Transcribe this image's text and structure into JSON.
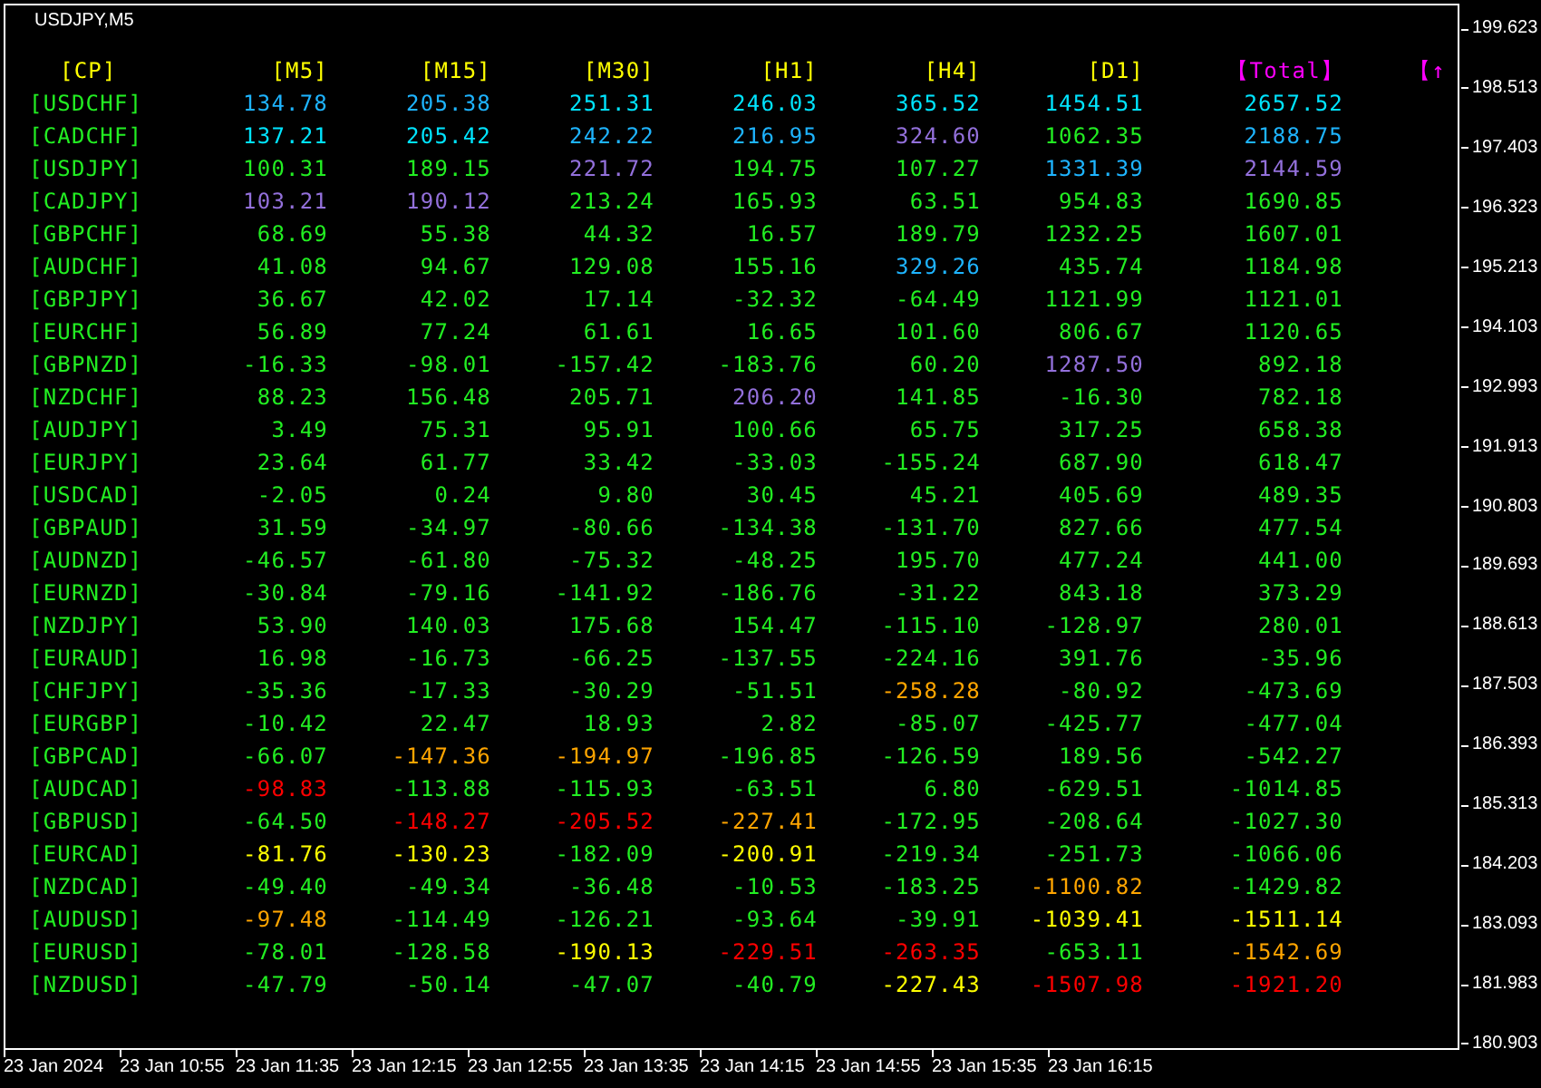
{
  "chart": {
    "symbol": "USDJPY,M5"
  },
  "table": {
    "columns": [
      {
        "label": "[CP]",
        "color": "#ffff00"
      },
      {
        "label": "[M5]",
        "color": "#ffff00"
      },
      {
        "label": "[M15]",
        "color": "#ffff00"
      },
      {
        "label": "[M30]",
        "color": "#ffff00"
      },
      {
        "label": "[H1]",
        "color": "#ffff00"
      },
      {
        "label": "[H4]",
        "color": "#ffff00"
      },
      {
        "label": "[D1]",
        "color": "#ffff00"
      },
      {
        "label": "【Total】",
        "color": "#ff00ff"
      },
      {
        "label": "【↑",
        "color": "#ff00ff"
      }
    ],
    "rows": [
      {
        "cells": [
          {
            "value": "[USDCHF]",
            "color": "#22ee22"
          },
          {
            "value": "134.78",
            "color": "#1eb4ff"
          },
          {
            "value": "205.38",
            "color": "#1eb4ff"
          },
          {
            "value": "251.31",
            "color": "#00e4ff"
          },
          {
            "value": "246.03",
            "color": "#00e4ff"
          },
          {
            "value": "365.52",
            "color": "#00e4ff"
          },
          {
            "value": "1454.51",
            "color": "#00e4ff"
          },
          {
            "value": "2657.52",
            "color": "#00e4ff"
          }
        ]
      },
      {
        "cells": [
          {
            "value": "[CADCHF]",
            "color": "#22ee22"
          },
          {
            "value": "137.21",
            "color": "#00e4ff"
          },
          {
            "value": "205.42",
            "color": "#00e4ff"
          },
          {
            "value": "242.22",
            "color": "#1eb4ff"
          },
          {
            "value": "216.95",
            "color": "#1eb4ff"
          },
          {
            "value": "324.60",
            "color": "#9370db"
          },
          {
            "value": "1062.35",
            "color": "#22ee22"
          },
          {
            "value": "2188.75",
            "color": "#1eb4ff"
          }
        ]
      },
      {
        "cells": [
          {
            "value": "[USDJPY]",
            "color": "#22ee22"
          },
          {
            "value": "100.31",
            "color": "#22ee22"
          },
          {
            "value": "189.15",
            "color": "#22ee22"
          },
          {
            "value": "221.72",
            "color": "#9370db"
          },
          {
            "value": "194.75",
            "color": "#22ee22"
          },
          {
            "value": "107.27",
            "color": "#22ee22"
          },
          {
            "value": "1331.39",
            "color": "#1eb4ff"
          },
          {
            "value": "2144.59",
            "color": "#9370db"
          }
        ]
      },
      {
        "cells": [
          {
            "value": "[CADJPY]",
            "color": "#22ee22"
          },
          {
            "value": "103.21",
            "color": "#9370db"
          },
          {
            "value": "190.12",
            "color": "#9370db"
          },
          {
            "value": "213.24",
            "color": "#22ee22"
          },
          {
            "value": "165.93",
            "color": "#22ee22"
          },
          {
            "value": "63.51",
            "color": "#22ee22"
          },
          {
            "value": "954.83",
            "color": "#22ee22"
          },
          {
            "value": "1690.85",
            "color": "#22ee22"
          }
        ]
      },
      {
        "cells": [
          {
            "value": "[GBPCHF]",
            "color": "#22ee22"
          },
          {
            "value": "68.69",
            "color": "#22ee22"
          },
          {
            "value": "55.38",
            "color": "#22ee22"
          },
          {
            "value": "44.32",
            "color": "#22ee22"
          },
          {
            "value": "16.57",
            "color": "#22ee22"
          },
          {
            "value": "189.79",
            "color": "#22ee22"
          },
          {
            "value": "1232.25",
            "color": "#22ee22"
          },
          {
            "value": "1607.01",
            "color": "#22ee22"
          }
        ]
      },
      {
        "cells": [
          {
            "value": "[AUDCHF]",
            "color": "#22ee22"
          },
          {
            "value": "41.08",
            "color": "#22ee22"
          },
          {
            "value": "94.67",
            "color": "#22ee22"
          },
          {
            "value": "129.08",
            "color": "#22ee22"
          },
          {
            "value": "155.16",
            "color": "#22ee22"
          },
          {
            "value": "329.26",
            "color": "#1eb4ff"
          },
          {
            "value": "435.74",
            "color": "#22ee22"
          },
          {
            "value": "1184.98",
            "color": "#22ee22"
          }
        ]
      },
      {
        "cells": [
          {
            "value": "[GBPJPY]",
            "color": "#22ee22"
          },
          {
            "value": "36.67",
            "color": "#22ee22"
          },
          {
            "value": "42.02",
            "color": "#22ee22"
          },
          {
            "value": "17.14",
            "color": "#22ee22"
          },
          {
            "value": "-32.32",
            "color": "#22ee22"
          },
          {
            "value": "-64.49",
            "color": "#22ee22"
          },
          {
            "value": "1121.99",
            "color": "#22ee22"
          },
          {
            "value": "1121.01",
            "color": "#22ee22"
          }
        ]
      },
      {
        "cells": [
          {
            "value": "[EURCHF]",
            "color": "#22ee22"
          },
          {
            "value": "56.89",
            "color": "#22ee22"
          },
          {
            "value": "77.24",
            "color": "#22ee22"
          },
          {
            "value": "61.61",
            "color": "#22ee22"
          },
          {
            "value": "16.65",
            "color": "#22ee22"
          },
          {
            "value": "101.60",
            "color": "#22ee22"
          },
          {
            "value": "806.67",
            "color": "#22ee22"
          },
          {
            "value": "1120.65",
            "color": "#22ee22"
          }
        ]
      },
      {
        "cells": [
          {
            "value": "[GBPNZD]",
            "color": "#22ee22"
          },
          {
            "value": "-16.33",
            "color": "#22ee22"
          },
          {
            "value": "-98.01",
            "color": "#22ee22"
          },
          {
            "value": "-157.42",
            "color": "#22ee22"
          },
          {
            "value": "-183.76",
            "color": "#22ee22"
          },
          {
            "value": "60.20",
            "color": "#22ee22"
          },
          {
            "value": "1287.50",
            "color": "#9370db"
          },
          {
            "value": "892.18",
            "color": "#22ee22"
          }
        ]
      },
      {
        "cells": [
          {
            "value": "[NZDCHF]",
            "color": "#22ee22"
          },
          {
            "value": "88.23",
            "color": "#22ee22"
          },
          {
            "value": "156.48",
            "color": "#22ee22"
          },
          {
            "value": "205.71",
            "color": "#22ee22"
          },
          {
            "value": "206.20",
            "color": "#9370db"
          },
          {
            "value": "141.85",
            "color": "#22ee22"
          },
          {
            "value": "-16.30",
            "color": "#22ee22"
          },
          {
            "value": "782.18",
            "color": "#22ee22"
          }
        ]
      },
      {
        "cells": [
          {
            "value": "[AUDJPY]",
            "color": "#22ee22"
          },
          {
            "value": "3.49",
            "color": "#22ee22"
          },
          {
            "value": "75.31",
            "color": "#22ee22"
          },
          {
            "value": "95.91",
            "color": "#22ee22"
          },
          {
            "value": "100.66",
            "color": "#22ee22"
          },
          {
            "value": "65.75",
            "color": "#22ee22"
          },
          {
            "value": "317.25",
            "color": "#22ee22"
          },
          {
            "value": "658.38",
            "color": "#22ee22"
          }
        ]
      },
      {
        "cells": [
          {
            "value": "[EURJPY]",
            "color": "#22ee22"
          },
          {
            "value": "23.64",
            "color": "#22ee22"
          },
          {
            "value": "61.77",
            "color": "#22ee22"
          },
          {
            "value": "33.42",
            "color": "#22ee22"
          },
          {
            "value": "-33.03",
            "color": "#22ee22"
          },
          {
            "value": "-155.24",
            "color": "#22ee22"
          },
          {
            "value": "687.90",
            "color": "#22ee22"
          },
          {
            "value": "618.47",
            "color": "#22ee22"
          }
        ]
      },
      {
        "cells": [
          {
            "value": "[USDCAD]",
            "color": "#22ee22"
          },
          {
            "value": "-2.05",
            "color": "#22ee22"
          },
          {
            "value": "0.24",
            "color": "#22ee22"
          },
          {
            "value": "9.80",
            "color": "#22ee22"
          },
          {
            "value": "30.45",
            "color": "#22ee22"
          },
          {
            "value": "45.21",
            "color": "#22ee22"
          },
          {
            "value": "405.69",
            "color": "#22ee22"
          },
          {
            "value": "489.35",
            "color": "#22ee22"
          }
        ]
      },
      {
        "cells": [
          {
            "value": "[GBPAUD]",
            "color": "#22ee22"
          },
          {
            "value": "31.59",
            "color": "#22ee22"
          },
          {
            "value": "-34.97",
            "color": "#22ee22"
          },
          {
            "value": "-80.66",
            "color": "#22ee22"
          },
          {
            "value": "-134.38",
            "color": "#22ee22"
          },
          {
            "value": "-131.70",
            "color": "#22ee22"
          },
          {
            "value": "827.66",
            "color": "#22ee22"
          },
          {
            "value": "477.54",
            "color": "#22ee22"
          }
        ]
      },
      {
        "cells": [
          {
            "value": "[AUDNZD]",
            "color": "#22ee22"
          },
          {
            "value": "-46.57",
            "color": "#22ee22"
          },
          {
            "value": "-61.80",
            "color": "#22ee22"
          },
          {
            "value": "-75.32",
            "color": "#22ee22"
          },
          {
            "value": "-48.25",
            "color": "#22ee22"
          },
          {
            "value": "195.70",
            "color": "#22ee22"
          },
          {
            "value": "477.24",
            "color": "#22ee22"
          },
          {
            "value": "441.00",
            "color": "#22ee22"
          }
        ]
      },
      {
        "cells": [
          {
            "value": "[EURNZD]",
            "color": "#22ee22"
          },
          {
            "value": "-30.84",
            "color": "#22ee22"
          },
          {
            "value": "-79.16",
            "color": "#22ee22"
          },
          {
            "value": "-141.92",
            "color": "#22ee22"
          },
          {
            "value": "-186.76",
            "color": "#22ee22"
          },
          {
            "value": "-31.22",
            "color": "#22ee22"
          },
          {
            "value": "843.18",
            "color": "#22ee22"
          },
          {
            "value": "373.29",
            "color": "#22ee22"
          }
        ]
      },
      {
        "cells": [
          {
            "value": "[NZDJPY]",
            "color": "#22ee22"
          },
          {
            "value": "53.90",
            "color": "#22ee22"
          },
          {
            "value": "140.03",
            "color": "#22ee22"
          },
          {
            "value": "175.68",
            "color": "#22ee22"
          },
          {
            "value": "154.47",
            "color": "#22ee22"
          },
          {
            "value": "-115.10",
            "color": "#22ee22"
          },
          {
            "value": "-128.97",
            "color": "#22ee22"
          },
          {
            "value": "280.01",
            "color": "#22ee22"
          }
        ]
      },
      {
        "cells": [
          {
            "value": "[EURAUD]",
            "color": "#22ee22"
          },
          {
            "value": "16.98",
            "color": "#22ee22"
          },
          {
            "value": "-16.73",
            "color": "#22ee22"
          },
          {
            "value": "-66.25",
            "color": "#22ee22"
          },
          {
            "value": "-137.55",
            "color": "#22ee22"
          },
          {
            "value": "-224.16",
            "color": "#22ee22"
          },
          {
            "value": "391.76",
            "color": "#22ee22"
          },
          {
            "value": "-35.96",
            "color": "#22ee22"
          }
        ]
      },
      {
        "cells": [
          {
            "value": "[CHFJPY]",
            "color": "#22ee22"
          },
          {
            "value": "-35.36",
            "color": "#22ee22"
          },
          {
            "value": "-17.33",
            "color": "#22ee22"
          },
          {
            "value": "-30.29",
            "color": "#22ee22"
          },
          {
            "value": "-51.51",
            "color": "#22ee22"
          },
          {
            "value": "-258.28",
            "color": "#ffa500"
          },
          {
            "value": "-80.92",
            "color": "#22ee22"
          },
          {
            "value": "-473.69",
            "color": "#22ee22"
          }
        ]
      },
      {
        "cells": [
          {
            "value": "[EURGBP]",
            "color": "#22ee22"
          },
          {
            "value": "-10.42",
            "color": "#22ee22"
          },
          {
            "value": "22.47",
            "color": "#22ee22"
          },
          {
            "value": "18.93",
            "color": "#22ee22"
          },
          {
            "value": "2.82",
            "color": "#22ee22"
          },
          {
            "value": "-85.07",
            "color": "#22ee22"
          },
          {
            "value": "-425.77",
            "color": "#22ee22"
          },
          {
            "value": "-477.04",
            "color": "#22ee22"
          }
        ]
      },
      {
        "cells": [
          {
            "value": "[GBPCAD]",
            "color": "#22ee22"
          },
          {
            "value": "-66.07",
            "color": "#22ee22"
          },
          {
            "value": "-147.36",
            "color": "#ffa500"
          },
          {
            "value": "-194.97",
            "color": "#ffa500"
          },
          {
            "value": "-196.85",
            "color": "#22ee22"
          },
          {
            "value": "-126.59",
            "color": "#22ee22"
          },
          {
            "value": "189.56",
            "color": "#22ee22"
          },
          {
            "value": "-542.27",
            "color": "#22ee22"
          }
        ]
      },
      {
        "cells": [
          {
            "value": "[AUDCAD]",
            "color": "#22ee22"
          },
          {
            "value": "-98.83",
            "color": "#ff0000"
          },
          {
            "value": "-113.88",
            "color": "#22ee22"
          },
          {
            "value": "-115.93",
            "color": "#22ee22"
          },
          {
            "value": "-63.51",
            "color": "#22ee22"
          },
          {
            "value": "6.80",
            "color": "#22ee22"
          },
          {
            "value": "-629.51",
            "color": "#22ee22"
          },
          {
            "value": "-1014.85",
            "color": "#22ee22"
          }
        ]
      },
      {
        "cells": [
          {
            "value": "[GBPUSD]",
            "color": "#22ee22"
          },
          {
            "value": "-64.50",
            "color": "#22ee22"
          },
          {
            "value": "-148.27",
            "color": "#ff0000"
          },
          {
            "value": "-205.52",
            "color": "#ff0000"
          },
          {
            "value": "-227.41",
            "color": "#ffa500"
          },
          {
            "value": "-172.95",
            "color": "#22ee22"
          },
          {
            "value": "-208.64",
            "color": "#22ee22"
          },
          {
            "value": "-1027.30",
            "color": "#22ee22"
          }
        ]
      },
      {
        "cells": [
          {
            "value": "[EURCAD]",
            "color": "#22ee22"
          },
          {
            "value": "-81.76",
            "color": "#ffff00"
          },
          {
            "value": "-130.23",
            "color": "#ffff00"
          },
          {
            "value": "-182.09",
            "color": "#22ee22"
          },
          {
            "value": "-200.91",
            "color": "#ffff00"
          },
          {
            "value": "-219.34",
            "color": "#22ee22"
          },
          {
            "value": "-251.73",
            "color": "#22ee22"
          },
          {
            "value": "-1066.06",
            "color": "#22ee22"
          }
        ]
      },
      {
        "cells": [
          {
            "value": "[NZDCAD]",
            "color": "#22ee22"
          },
          {
            "value": "-49.40",
            "color": "#22ee22"
          },
          {
            "value": "-49.34",
            "color": "#22ee22"
          },
          {
            "value": "-36.48",
            "color": "#22ee22"
          },
          {
            "value": "-10.53",
            "color": "#22ee22"
          },
          {
            "value": "-183.25",
            "color": "#22ee22"
          },
          {
            "value": "-1100.82",
            "color": "#ffa500"
          },
          {
            "value": "-1429.82",
            "color": "#22ee22"
          }
        ]
      },
      {
        "cells": [
          {
            "value": "[AUDUSD]",
            "color": "#22ee22"
          },
          {
            "value": "-97.48",
            "color": "#ffa500"
          },
          {
            "value": "-114.49",
            "color": "#22ee22"
          },
          {
            "value": "-126.21",
            "color": "#22ee22"
          },
          {
            "value": "-93.64",
            "color": "#22ee22"
          },
          {
            "value": "-39.91",
            "color": "#22ee22"
          },
          {
            "value": "-1039.41",
            "color": "#ffff00"
          },
          {
            "value": "-1511.14",
            "color": "#ffff00"
          }
        ]
      },
      {
        "cells": [
          {
            "value": "[EURUSD]",
            "color": "#22ee22"
          },
          {
            "value": "-78.01",
            "color": "#22ee22"
          },
          {
            "value": "-128.58",
            "color": "#22ee22"
          },
          {
            "value": "-190.13",
            "color": "#ffff00"
          },
          {
            "value": "-229.51",
            "color": "#ff0000"
          },
          {
            "value": "-263.35",
            "color": "#ff0000"
          },
          {
            "value": "-653.11",
            "color": "#22ee22"
          },
          {
            "value": "-1542.69",
            "color": "#ffa500"
          }
        ]
      },
      {
        "cells": [
          {
            "value": "[NZDUSD]",
            "color": "#22ee22"
          },
          {
            "value": "-47.79",
            "color": "#22ee22"
          },
          {
            "value": "-50.14",
            "color": "#22ee22"
          },
          {
            "value": "-47.07",
            "color": "#22ee22"
          },
          {
            "value": "-40.79",
            "color": "#22ee22"
          },
          {
            "value": "-227.43",
            "color": "#ffff00"
          },
          {
            "value": "-1507.98",
            "color": "#ff0000"
          },
          {
            "value": "-1921.20",
            "color": "#ff0000"
          }
        ]
      }
    ]
  },
  "price_axis": [
    "199.623",
    "198.513",
    "197.403",
    "196.323",
    "195.213",
    "194.103",
    "192.993",
    "191.913",
    "190.803",
    "189.693",
    "188.613",
    "187.503",
    "186.393",
    "185.313",
    "184.203",
    "183.093",
    "181.983",
    "180.903"
  ],
  "time_axis": [
    "23 Jan 2024",
    "23 Jan 10:55",
    "23 Jan 11:35",
    "23 Jan 12:15",
    "23 Jan 12:55",
    "23 Jan 13:35",
    "23 Jan 14:15",
    "23 Jan 14:55",
    "23 Jan 15:35",
    "23 Jan 16:15"
  ]
}
